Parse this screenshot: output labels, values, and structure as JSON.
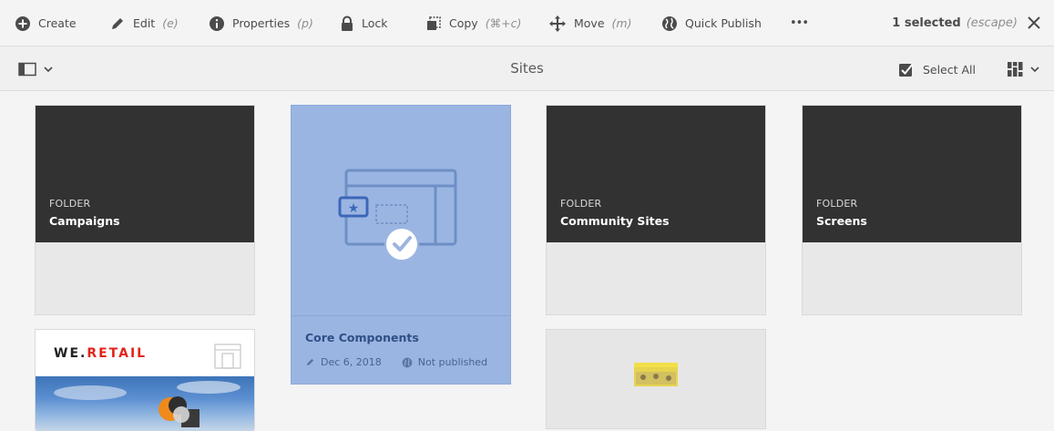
{
  "toolbar": {
    "create": "Create",
    "edit": "Edit",
    "edit_kb": "(e)",
    "properties": "Properties",
    "properties_kb": "(p)",
    "lock": "Lock",
    "copy": "Copy",
    "copy_kb": "(⌘+c)",
    "move": "Move",
    "move_kb": "(m)",
    "quick_publish": "Quick Publish",
    "more": "•••",
    "selected_count": "1 selected",
    "escape": "(escape)"
  },
  "header": {
    "title": "Sites",
    "select_all": "Select All"
  },
  "cards": {
    "campaigns": {
      "type": "FOLDER",
      "name": "Campaigns"
    },
    "core": {
      "name": "Core Components",
      "date": "Dec 6, 2018",
      "status": "Not published"
    },
    "community": {
      "type": "FOLDER",
      "name": "Community Sites"
    },
    "screens": {
      "type": "FOLDER",
      "name": "Screens"
    },
    "weretail": {
      "logo_left": "WE.",
      "logo_right": "RETAIL"
    }
  },
  "colors": {
    "selected_bg": "#9bb5e2",
    "folder_thumb": "#323232",
    "brand_red": "#e1251b"
  }
}
